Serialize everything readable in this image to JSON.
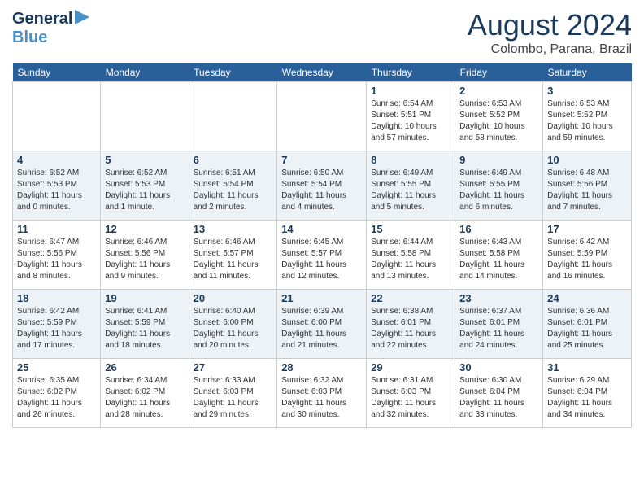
{
  "header": {
    "logo_line1": "General",
    "logo_line2": "Blue",
    "month_year": "August 2024",
    "location": "Colombo, Parana, Brazil"
  },
  "days_of_week": [
    "Sunday",
    "Monday",
    "Tuesday",
    "Wednesday",
    "Thursday",
    "Friday",
    "Saturday"
  ],
  "weeks": [
    [
      {
        "day": "",
        "info": ""
      },
      {
        "day": "",
        "info": ""
      },
      {
        "day": "",
        "info": ""
      },
      {
        "day": "",
        "info": ""
      },
      {
        "day": "1",
        "info": "Sunrise: 6:54 AM\nSunset: 5:51 PM\nDaylight: 10 hours\nand 57 minutes."
      },
      {
        "day": "2",
        "info": "Sunrise: 6:53 AM\nSunset: 5:52 PM\nDaylight: 10 hours\nand 58 minutes."
      },
      {
        "day": "3",
        "info": "Sunrise: 6:53 AM\nSunset: 5:52 PM\nDaylight: 10 hours\nand 59 minutes."
      }
    ],
    [
      {
        "day": "4",
        "info": "Sunrise: 6:52 AM\nSunset: 5:53 PM\nDaylight: 11 hours\nand 0 minutes."
      },
      {
        "day": "5",
        "info": "Sunrise: 6:52 AM\nSunset: 5:53 PM\nDaylight: 11 hours\nand 1 minute."
      },
      {
        "day": "6",
        "info": "Sunrise: 6:51 AM\nSunset: 5:54 PM\nDaylight: 11 hours\nand 2 minutes."
      },
      {
        "day": "7",
        "info": "Sunrise: 6:50 AM\nSunset: 5:54 PM\nDaylight: 11 hours\nand 4 minutes."
      },
      {
        "day": "8",
        "info": "Sunrise: 6:49 AM\nSunset: 5:55 PM\nDaylight: 11 hours\nand 5 minutes."
      },
      {
        "day": "9",
        "info": "Sunrise: 6:49 AM\nSunset: 5:55 PM\nDaylight: 11 hours\nand 6 minutes."
      },
      {
        "day": "10",
        "info": "Sunrise: 6:48 AM\nSunset: 5:56 PM\nDaylight: 11 hours\nand 7 minutes."
      }
    ],
    [
      {
        "day": "11",
        "info": "Sunrise: 6:47 AM\nSunset: 5:56 PM\nDaylight: 11 hours\nand 8 minutes."
      },
      {
        "day": "12",
        "info": "Sunrise: 6:46 AM\nSunset: 5:56 PM\nDaylight: 11 hours\nand 9 minutes."
      },
      {
        "day": "13",
        "info": "Sunrise: 6:46 AM\nSunset: 5:57 PM\nDaylight: 11 hours\nand 11 minutes."
      },
      {
        "day": "14",
        "info": "Sunrise: 6:45 AM\nSunset: 5:57 PM\nDaylight: 11 hours\nand 12 minutes."
      },
      {
        "day": "15",
        "info": "Sunrise: 6:44 AM\nSunset: 5:58 PM\nDaylight: 11 hours\nand 13 minutes."
      },
      {
        "day": "16",
        "info": "Sunrise: 6:43 AM\nSunset: 5:58 PM\nDaylight: 11 hours\nand 14 minutes."
      },
      {
        "day": "17",
        "info": "Sunrise: 6:42 AM\nSunset: 5:59 PM\nDaylight: 11 hours\nand 16 minutes."
      }
    ],
    [
      {
        "day": "18",
        "info": "Sunrise: 6:42 AM\nSunset: 5:59 PM\nDaylight: 11 hours\nand 17 minutes."
      },
      {
        "day": "19",
        "info": "Sunrise: 6:41 AM\nSunset: 5:59 PM\nDaylight: 11 hours\nand 18 minutes."
      },
      {
        "day": "20",
        "info": "Sunrise: 6:40 AM\nSunset: 6:00 PM\nDaylight: 11 hours\nand 20 minutes."
      },
      {
        "day": "21",
        "info": "Sunrise: 6:39 AM\nSunset: 6:00 PM\nDaylight: 11 hours\nand 21 minutes."
      },
      {
        "day": "22",
        "info": "Sunrise: 6:38 AM\nSunset: 6:01 PM\nDaylight: 11 hours\nand 22 minutes."
      },
      {
        "day": "23",
        "info": "Sunrise: 6:37 AM\nSunset: 6:01 PM\nDaylight: 11 hours\nand 24 minutes."
      },
      {
        "day": "24",
        "info": "Sunrise: 6:36 AM\nSunset: 6:01 PM\nDaylight: 11 hours\nand 25 minutes."
      }
    ],
    [
      {
        "day": "25",
        "info": "Sunrise: 6:35 AM\nSunset: 6:02 PM\nDaylight: 11 hours\nand 26 minutes."
      },
      {
        "day": "26",
        "info": "Sunrise: 6:34 AM\nSunset: 6:02 PM\nDaylight: 11 hours\nand 28 minutes."
      },
      {
        "day": "27",
        "info": "Sunrise: 6:33 AM\nSunset: 6:03 PM\nDaylight: 11 hours\nand 29 minutes."
      },
      {
        "day": "28",
        "info": "Sunrise: 6:32 AM\nSunset: 6:03 PM\nDaylight: 11 hours\nand 30 minutes."
      },
      {
        "day": "29",
        "info": "Sunrise: 6:31 AM\nSunset: 6:03 PM\nDaylight: 11 hours\nand 32 minutes."
      },
      {
        "day": "30",
        "info": "Sunrise: 6:30 AM\nSunset: 6:04 PM\nDaylight: 11 hours\nand 33 minutes."
      },
      {
        "day": "31",
        "info": "Sunrise: 6:29 AM\nSunset: 6:04 PM\nDaylight: 11 hours\nand 34 minutes."
      }
    ]
  ]
}
